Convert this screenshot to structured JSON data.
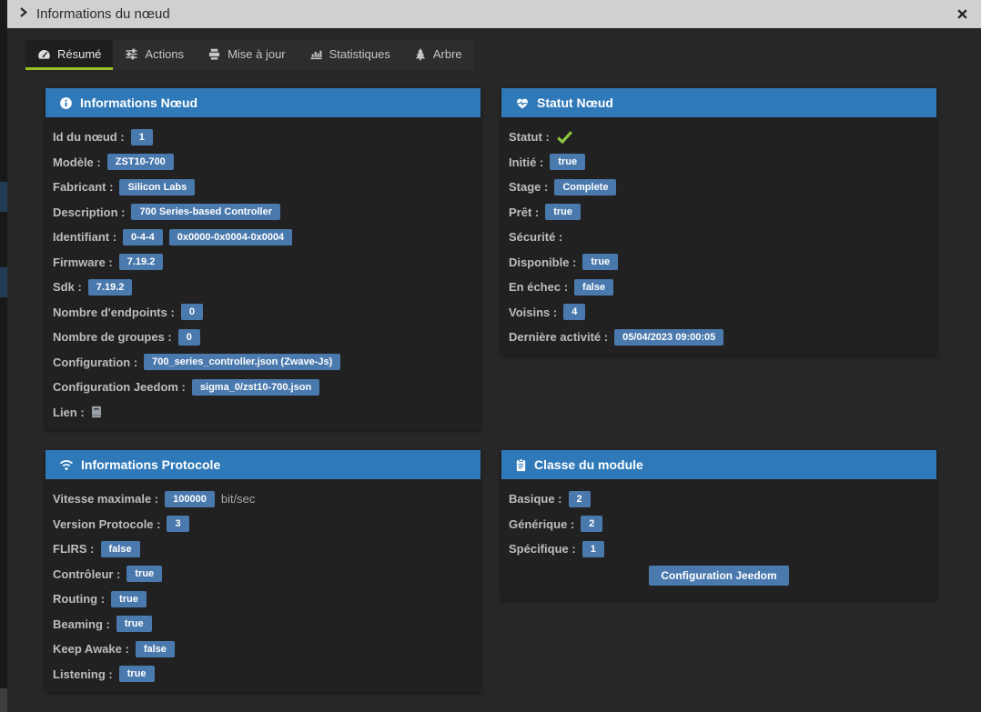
{
  "window": {
    "title": "Informations du nœud",
    "title_icon": "chevron-right-icon",
    "close_icon": "close-icon"
  },
  "colors": {
    "header_blue": "#2f79b9",
    "badge_blue": "#4a79ad",
    "success_green": "#8bc63f",
    "tab_underline_green": "#99c21f"
  },
  "tabs": [
    {
      "label": "Résumé",
      "icon": "gauge-icon",
      "active": true
    },
    {
      "label": "Actions",
      "icon": "sliders-icon",
      "active": false
    },
    {
      "label": "Mise à jour",
      "icon": "update-icon",
      "active": false
    },
    {
      "label": "Statistiques",
      "icon": "bar-chart-icon",
      "active": false
    },
    {
      "label": "Arbre",
      "icon": "tree-icon",
      "active": false
    }
  ],
  "panels": [
    {
      "name": "node-info",
      "title": "Informations Nœud",
      "icon": "info-circle-icon",
      "rows": [
        {
          "label": "Id du nœud :",
          "badges": [
            "1"
          ]
        },
        {
          "label": "Modèle :",
          "badges": [
            "ZST10-700"
          ]
        },
        {
          "label": "Fabricant :",
          "badges": [
            "Silicon Labs"
          ]
        },
        {
          "label": "Description :",
          "badges": [
            "700 Series-based Controller"
          ]
        },
        {
          "label": "Identifiant :",
          "badges": [
            "0-4-4",
            "0x0000-0x0004-0x0004"
          ]
        },
        {
          "label": "Firmware :",
          "badges": [
            "7.19.2"
          ]
        },
        {
          "label": "Sdk :",
          "badges": [
            "7.19.2"
          ]
        },
        {
          "label": "Nombre d'endpoints :",
          "badges": [
            "0"
          ]
        },
        {
          "label": "Nombre de groupes :",
          "badges": [
            "0"
          ]
        },
        {
          "label": "Configuration :",
          "badges": [
            "700_series_controller.json (Zwave-Js)"
          ]
        },
        {
          "label": "Configuration Jeedom :",
          "badges": [
            "sigma_0/zst10-700.json"
          ]
        },
        {
          "label": "Lien :",
          "icon": "book-icon",
          "icon_interactable": true
        }
      ]
    },
    {
      "name": "node-status",
      "title": "Statut Nœud",
      "icon": "heartbeat-icon",
      "rows": [
        {
          "label": "Statut :",
          "icon": "check-icon",
          "icon_interactable": false
        },
        {
          "label": "Initié :",
          "badges": [
            "true"
          ]
        },
        {
          "label": "Stage :",
          "badges": [
            "Complete"
          ]
        },
        {
          "label": "Prêt :",
          "badges": [
            "true"
          ]
        },
        {
          "label": "Sécurité :"
        },
        {
          "label": "Disponible :",
          "badges": [
            "true"
          ]
        },
        {
          "label": "En échec :",
          "badges": [
            "false"
          ]
        },
        {
          "label": "Voisins :",
          "badges": [
            "4"
          ]
        },
        {
          "label": "Dernière activité :",
          "badges": [
            "05/04/2023 09:00:05"
          ]
        }
      ]
    },
    {
      "name": "protocol-info",
      "title": "Informations Protocole",
      "icon": "wifi-icon",
      "rows": [
        {
          "label": "Vitesse maximale :",
          "badges": [
            "100000"
          ],
          "suffix": "bit/sec"
        },
        {
          "label": "Version Protocole :",
          "badges": [
            "3"
          ]
        },
        {
          "label": "FLIRS :",
          "badges": [
            "false"
          ]
        },
        {
          "label": "Contrôleur :",
          "badges": [
            "true"
          ]
        },
        {
          "label": "Routing :",
          "badges": [
            "true"
          ]
        },
        {
          "label": "Beaming :",
          "badges": [
            "true"
          ]
        },
        {
          "label": "Keep Awake :",
          "badges": [
            "false"
          ]
        },
        {
          "label": "Listening :",
          "badges": [
            "true"
          ]
        }
      ]
    },
    {
      "name": "module-class",
      "title": "Classe du module",
      "icon": "clipboard-icon",
      "rows": [
        {
          "label": "Basique :",
          "badges": [
            "2"
          ]
        },
        {
          "label": "Générique :",
          "badges": [
            "2"
          ]
        },
        {
          "label": "Spécifique :",
          "badges": [
            "1"
          ]
        }
      ],
      "button": "Configuration Jeedom"
    }
  ]
}
